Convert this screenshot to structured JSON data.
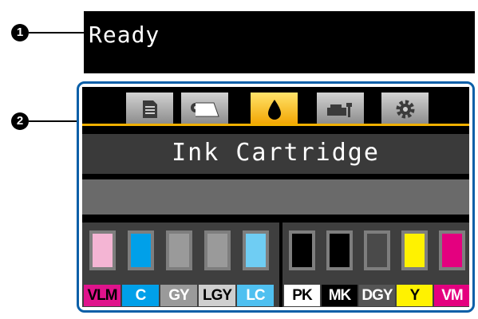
{
  "callouts": {
    "one": "1",
    "two": "2"
  },
  "status": {
    "text": "Ready"
  },
  "tabs": [
    {
      "name": "print-queue",
      "icon": "document-icon"
    },
    {
      "name": "paper",
      "icon": "paper-roll-icon"
    },
    {
      "name": "ink",
      "icon": "ink-drop-icon",
      "active": true
    },
    {
      "name": "maintenance",
      "icon": "maintenance-icon"
    },
    {
      "name": "setup",
      "icon": "gear-icon"
    }
  ],
  "title": "Ink Cartridge",
  "colors": {
    "accent": "#f0b000",
    "frame": "#0a5fa8"
  },
  "inks_left": [
    {
      "label": "VLM",
      "color": "#f4b5d4",
      "label_bg": "#e0138c",
      "label_fg": "#000000"
    },
    {
      "label": "C",
      "color": "#00a0e9",
      "label_bg": "#00a0e9",
      "label_fg": "#ffffff"
    },
    {
      "label": "GY",
      "color": "#9a9a9a",
      "label_bg": "#9a9a9a",
      "label_fg": "#ffffff"
    },
    {
      "label": "LGY",
      "color": "#9a9a9a",
      "label_bg": "#cfcfcf",
      "label_fg": "#000000"
    },
    {
      "label": "LC",
      "color": "#6fcdf3",
      "label_bg": "#4fc0f0",
      "label_fg": "#ffffff"
    }
  ],
  "inks_right": [
    {
      "label": "PK",
      "color": "#000000",
      "label_bg": "#ffffff",
      "label_fg": "#000000"
    },
    {
      "label": "MK",
      "color": "#000000",
      "label_bg": "#000000",
      "label_fg": "#ffffff"
    },
    {
      "label": "DGY",
      "color": "#4a4a4a",
      "label_bg": "#555555",
      "label_fg": "#ffffff"
    },
    {
      "label": "Y",
      "color": "#fff200",
      "label_bg": "#fff200",
      "label_fg": "#000000"
    },
    {
      "label": "VM",
      "color": "#e4007f",
      "label_bg": "#e4007f",
      "label_fg": "#ffffff"
    }
  ]
}
